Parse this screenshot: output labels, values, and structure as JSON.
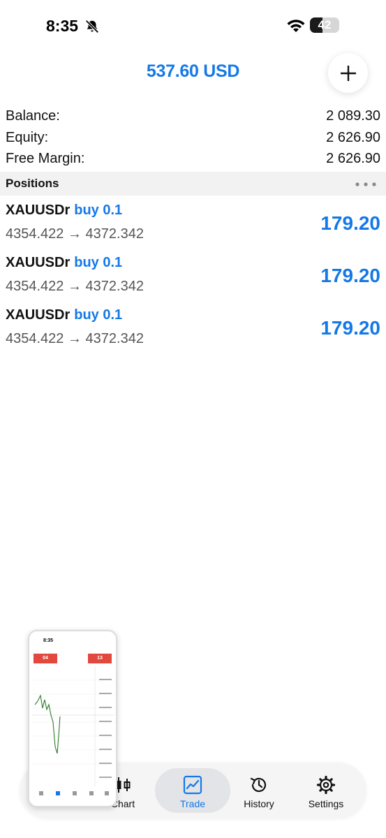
{
  "status_bar": {
    "time": "8:35",
    "battery_level": "42",
    "battery_fraction": 0.42,
    "icons": [
      "bell-slash-icon",
      "wifi-icon",
      "battery-icon"
    ]
  },
  "header": {
    "title": "537.60 USD",
    "add_icon": "plus-icon"
  },
  "summary": [
    {
      "label": "Balance:",
      "value": "2 089.30"
    },
    {
      "label": "Equity:",
      "value": "2 626.90"
    },
    {
      "label": "Free Margin:",
      "value": "2 626.90"
    }
  ],
  "positions": {
    "title": "Positions",
    "more_icon": "ellipsis-icon",
    "items": [
      {
        "symbol": "XAUUSDr",
        "side": "buy 0.1",
        "prices": "4354.422 → 4372.342",
        "profit": "179.20"
      },
      {
        "symbol": "XAUUSDr",
        "side": "buy 0.1",
        "prices": "4354.422 → 4372.342",
        "profit": "179.20"
      },
      {
        "symbol": "XAUUSDr",
        "side": "buy 0.1",
        "prices": "4354.422 → 4372.342",
        "profit": "179.20"
      }
    ]
  },
  "tab_bar": {
    "tabs": [
      {
        "label": "Chart",
        "icon": "candlestick-icon",
        "active": false
      },
      {
        "label": "Trade",
        "icon": "trend-chart-icon",
        "active": true
      },
      {
        "label": "History",
        "icon": "history-icon",
        "active": false
      },
      {
        "label": "Settings",
        "icon": "gear-icon",
        "active": false
      }
    ]
  },
  "thumbnail": {
    "time": "8:35",
    "sell_price": "04",
    "buy_price": "13"
  },
  "colors": {
    "accent": "#1479e6",
    "section_bg": "#f2f2f2",
    "tab_bar_bg": "#f5f5f5",
    "active_tab_bg": "#e3e4e8",
    "price_red": "#e2483d"
  }
}
